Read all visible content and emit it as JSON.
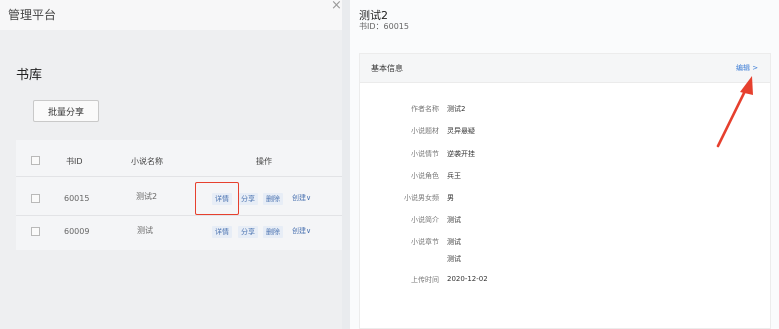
{
  "app": {
    "title": "管理平台"
  },
  "library": {
    "title": "书库",
    "batch_share_label": "批量分享",
    "columns": {
      "id": "书ID",
      "name": "小说名称",
      "ops": "操作"
    },
    "rows": [
      {
        "id": "60015",
        "name": "测试2"
      },
      {
        "id": "60009",
        "name": "测试"
      }
    ],
    "ops": {
      "detail": "详情",
      "share": "分享",
      "delete": "删除",
      "create": "创建∨"
    }
  },
  "drawer": {
    "close_icon": "×",
    "title": "测试2",
    "subtitle": "书ID：60015",
    "card": {
      "title": "基本信息",
      "edit_label": "编辑 >",
      "fields": [
        {
          "label": "作者名称",
          "value": "测试2"
        },
        {
          "label": "小说题材",
          "value": "灵异悬疑"
        },
        {
          "label": "小说情节",
          "value": "逆袭开挂"
        },
        {
          "label": "小说角色",
          "value": "兵王"
        },
        {
          "label": "小说男女频",
          "value": "男"
        },
        {
          "label": "小说简介",
          "value": "测试"
        },
        {
          "label": "小说章节",
          "value": "测试",
          "value2": "测试"
        },
        {
          "label": "上传时间",
          "value": "2020-12-02"
        }
      ]
    }
  },
  "colors": {
    "highlight": "#e6402e",
    "link": "#3a7bd5"
  }
}
